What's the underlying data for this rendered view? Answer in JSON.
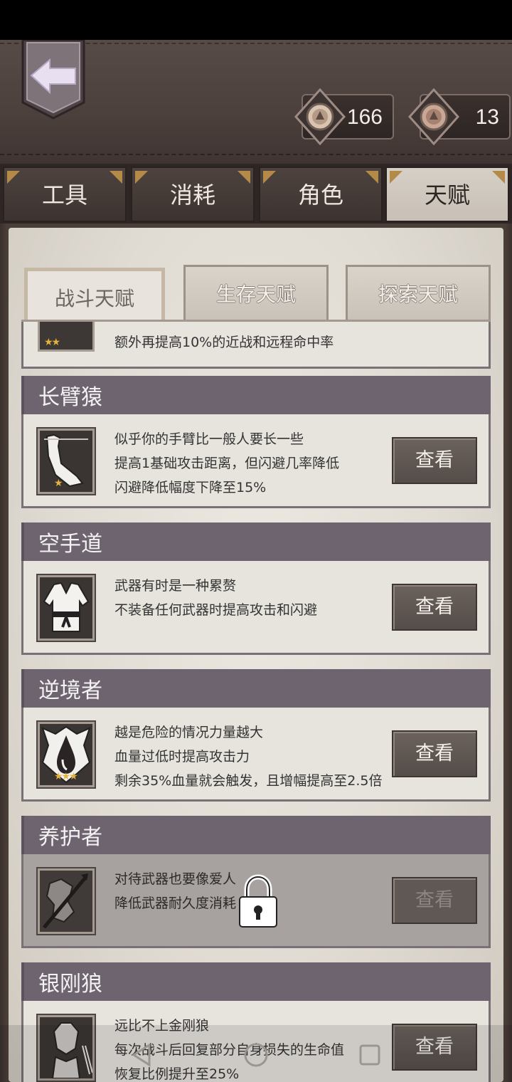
{
  "header": {
    "currencies": [
      {
        "icon": "medal-coin-icon",
        "value": "166"
      },
      {
        "icon": "medal-token-icon",
        "value": "13"
      }
    ]
  },
  "main_tabs": [
    {
      "label": "工具",
      "active": false
    },
    {
      "label": "消耗",
      "active": false
    },
    {
      "label": "角色",
      "active": false
    },
    {
      "label": "天赋",
      "active": true
    }
  ],
  "sub_tabs": [
    {
      "label": "战斗天赋",
      "active": true
    },
    {
      "label": "生存天赋",
      "active": false
    },
    {
      "label": "探索天赋",
      "active": false
    }
  ],
  "partial_item": {
    "desc": "额外再提高10%的近战和远程命中率",
    "stars": "★★"
  },
  "talents": [
    {
      "name": "长臂猿",
      "icon": "long-arm-icon",
      "stars": "★",
      "desc": [
        "似乎你的手臂比一般人要长一些",
        "提高1基础攻击距离，但闪避几率降低",
        "闪避降低幅度下降至15%"
      ],
      "button": "查看",
      "locked": false
    },
    {
      "name": "空手道",
      "icon": "karate-gi-icon",
      "stars": "",
      "desc": [
        "武器有时是一种累赘",
        "不装备任何武器时提高攻击和闪避"
      ],
      "button": "查看",
      "locked": false
    },
    {
      "name": "逆境者",
      "icon": "blood-drop-icon",
      "stars": "★★★",
      "desc": [
        "越是危险的情况力量越大",
        "血量过低时提高攻击力",
        "剩余35%血量就会触发，且增幅提高至2.5倍"
      ],
      "button": "查看",
      "locked": false
    },
    {
      "name": "养护者",
      "icon": "weapon-care-icon",
      "stars": "",
      "desc": [
        "对待武器也要像爱人",
        "降低武器耐久度消耗"
      ],
      "button": "查看",
      "locked": true
    },
    {
      "name": "银刚狼",
      "icon": "wolverine-icon",
      "stars": "",
      "desc": [
        "远比不上金刚狼",
        "每次战斗后回复部分自身损失的生命值",
        "恢复比例提升至25%"
      ],
      "button": "查看",
      "locked": false
    }
  ]
}
